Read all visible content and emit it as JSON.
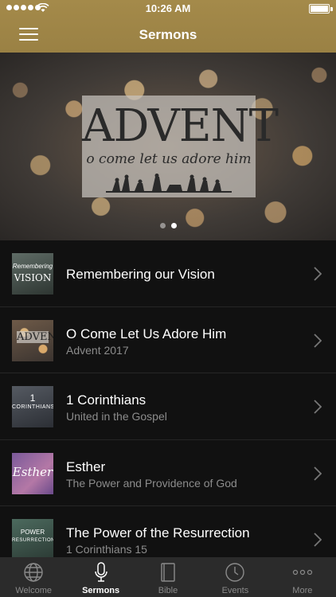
{
  "status_bar": {
    "time": "10:26 AM"
  },
  "header": {
    "title": "Sermons"
  },
  "banner": {
    "title": "ADVENT",
    "subtitle": "o come let us adore him",
    "page_count": 2,
    "active_page": 2
  },
  "sermons": [
    {
      "title": "Remembering our Vision",
      "subtitle": "",
      "thumb_text": "VISION",
      "thumb_small": "Remembering"
    },
    {
      "title": "O Come Let Us Adore Him",
      "subtitle": "Advent 2017",
      "thumb_text": "ADVENT",
      "thumb_small": ""
    },
    {
      "title": "1 Corinthians",
      "subtitle": "United in the Gospel",
      "thumb_text": "CORINTHIANS",
      "thumb_small": "1"
    },
    {
      "title": "Esther",
      "subtitle": "The Power and Providence of God",
      "thumb_text": "Esther",
      "thumb_small": ""
    },
    {
      "title": "The Power of the Resurrection",
      "subtitle": "1 Corinthians 15",
      "thumb_text": "RESURRECTION",
      "thumb_small": "POWER"
    }
  ],
  "tabs": [
    {
      "label": "Welcome",
      "icon": "globe-icon",
      "active": false
    },
    {
      "label": "Sermons",
      "icon": "microphone-icon",
      "active": true
    },
    {
      "label": "Bible",
      "icon": "book-icon",
      "active": false
    },
    {
      "label": "Events",
      "icon": "clock-icon",
      "active": false
    },
    {
      "label": "More",
      "icon": "more-icon",
      "active": false
    }
  ],
  "colors": {
    "header": "#a48a4a",
    "background": "#111111",
    "tabbar": "#2b2b2b"
  }
}
